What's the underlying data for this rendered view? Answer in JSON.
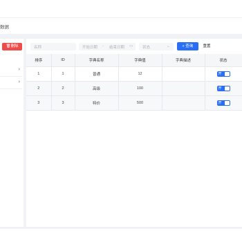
{
  "tab": {
    "label": "数据"
  },
  "toolbar": {
    "delete_label": "删除",
    "delete_icon": "trash-icon"
  },
  "filters": {
    "name_placeholder": "名称",
    "start_date": "开始日期",
    "date_separator": "-",
    "end_date": "结束日期",
    "date_icon": "calendar-icon",
    "status_placeholder": "状态",
    "status_icon": "chevron-down-icon",
    "query_label": "查询",
    "query_icon": "search-icon",
    "reset_label": "重置"
  },
  "table": {
    "headers": [
      "排序",
      "ID",
      "字典名称",
      "字典值",
      "字典描述",
      "状态"
    ],
    "rows": [
      {
        "sort": "1",
        "id": "1",
        "name": "普通",
        "value": "12",
        "desc": "",
        "status": "开"
      },
      {
        "sort": "2",
        "id": "2",
        "name": "高级",
        "value": "100",
        "desc": "",
        "status": "开"
      },
      {
        "sort": "3",
        "id": "3",
        "name": "特价",
        "value": "500",
        "desc": "",
        "status": "开"
      }
    ]
  },
  "colors": {
    "primary": "#2b6ef6",
    "danger": "#f04b4b",
    "background": "#f0f2f5"
  }
}
